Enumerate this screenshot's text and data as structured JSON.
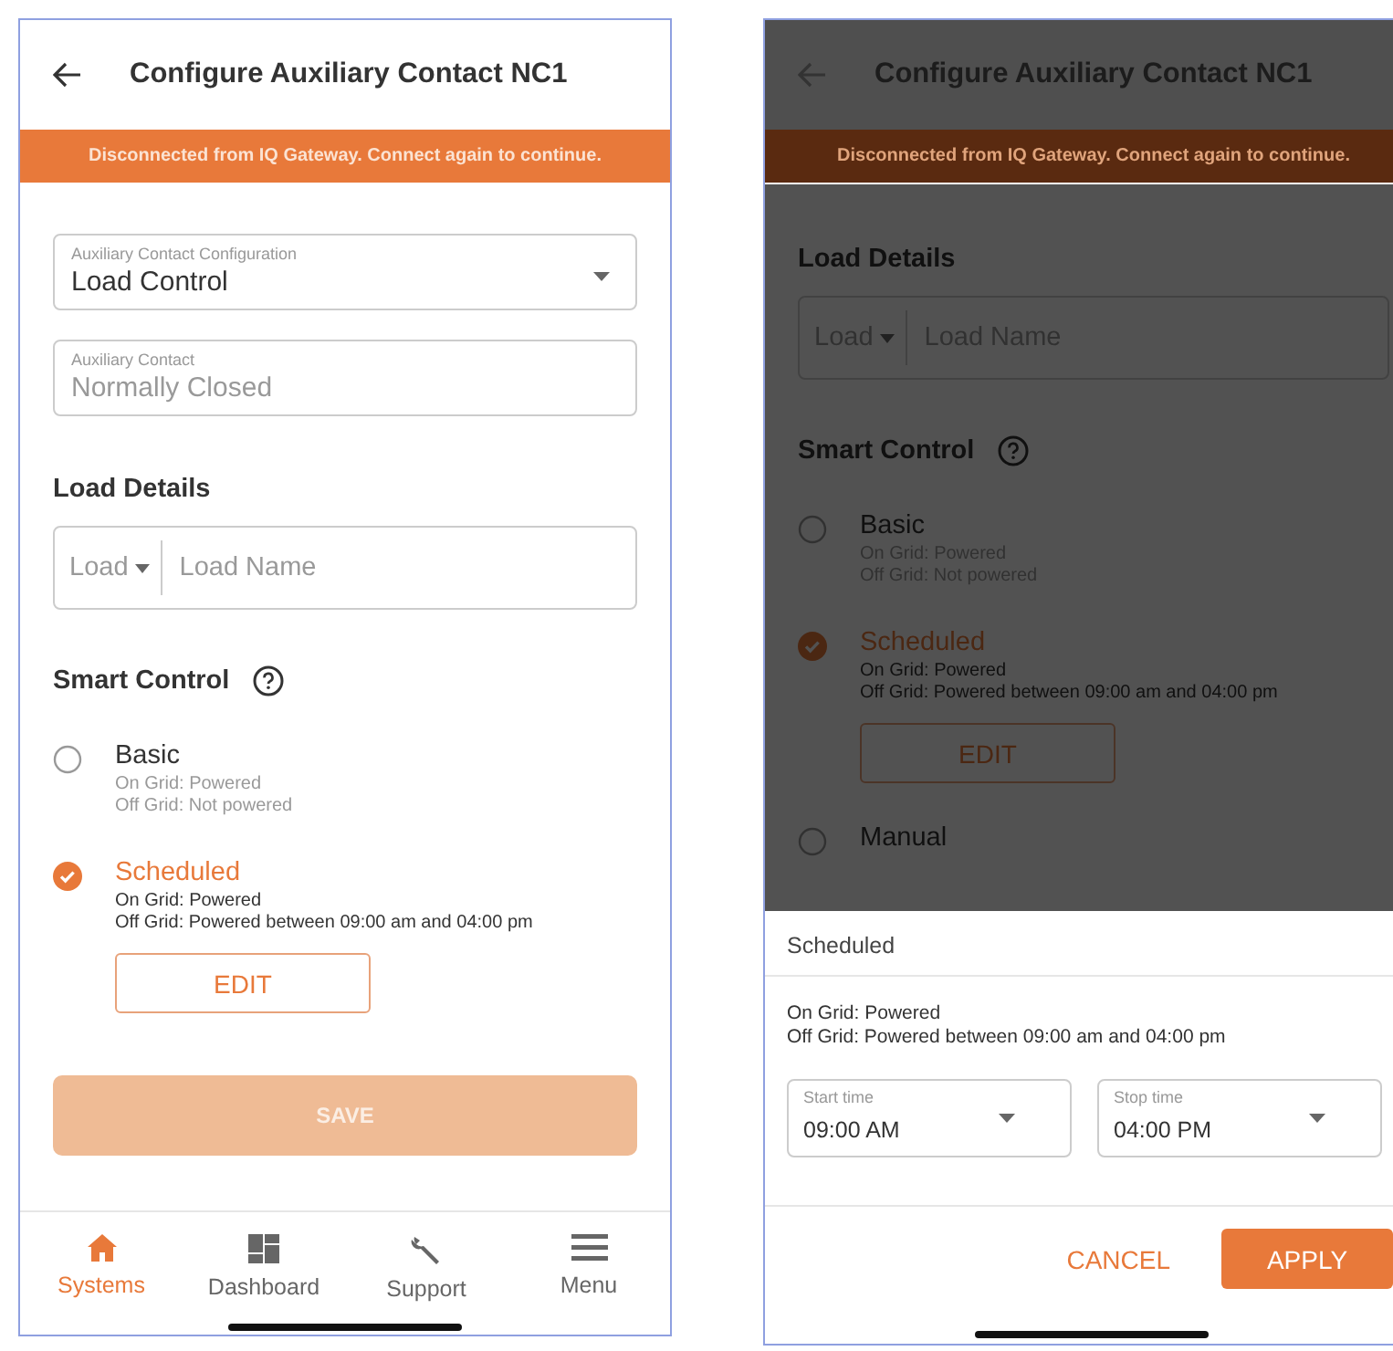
{
  "main_screen": {
    "header": {
      "title": "Configure Auxiliary Contact NC1"
    },
    "banner": "Disconnected from IQ Gateway. Connect again to continue.",
    "config_field": {
      "label": "Auxiliary Contact Configuration",
      "value": "Load Control"
    },
    "contact_field": {
      "label": "Auxiliary Contact",
      "value": "Normally Closed",
      "disabled": true
    },
    "load_details": {
      "heading": "Load Details",
      "type": "Load",
      "placeholder": "Load Name"
    },
    "smart_control": {
      "heading": "Smart Control",
      "options": [
        {
          "label": "Basic",
          "selected": false,
          "lines": [
            "On Grid: Powered",
            "Off Grid: Not powered"
          ]
        },
        {
          "label": "Scheduled",
          "selected": true,
          "lines": [
            "On Grid: Powered",
            "Off Grid: Powered between 09:00 am and 04:00 pm"
          ],
          "edit": "EDIT"
        }
      ]
    },
    "save_button": {
      "label": "SAVE",
      "disabled": true
    },
    "nav": [
      {
        "label": "Systems",
        "kind": "home",
        "selected": true
      },
      {
        "label": "Dashboard",
        "kind": "grid",
        "selected": false
      },
      {
        "label": "Support",
        "kind": "wrench",
        "selected": false
      },
      {
        "label": "Menu",
        "kind": "menu",
        "selected": false
      }
    ]
  },
  "dialog_screen": {
    "header": {
      "title": "Configure Auxiliary Contact NC1"
    },
    "banner": "Disconnected from IQ Gateway. Connect again to continue.",
    "load_details": {
      "heading": "Load Details",
      "type": "Load",
      "placeholder": "Load Name"
    },
    "smart_control": {
      "heading": "Smart Control",
      "options": [
        {
          "label": "Basic",
          "selected": false,
          "lines": [
            "On Grid: Powered",
            "Off Grid: Not powered"
          ]
        },
        {
          "label": "Scheduled",
          "selected": true,
          "lines": [
            "On Grid: Powered",
            "Off Grid: Powered between 09:00 am and 04:00 pm"
          ],
          "edit": "EDIT"
        },
        {
          "label": "Manual",
          "selected": false
        }
      ]
    },
    "sheet": {
      "title": "Scheduled",
      "lines": [
        "On Grid: Powered",
        "Off Grid: Powered between 09:00 am and 04:00 pm"
      ],
      "start_time": {
        "label": "Start time",
        "value": "09:00 AM"
      },
      "stop_time": {
        "label": "Stop time",
        "value": "04:00 PM"
      },
      "cancel": "CANCEL",
      "apply": "APPLY"
    }
  }
}
